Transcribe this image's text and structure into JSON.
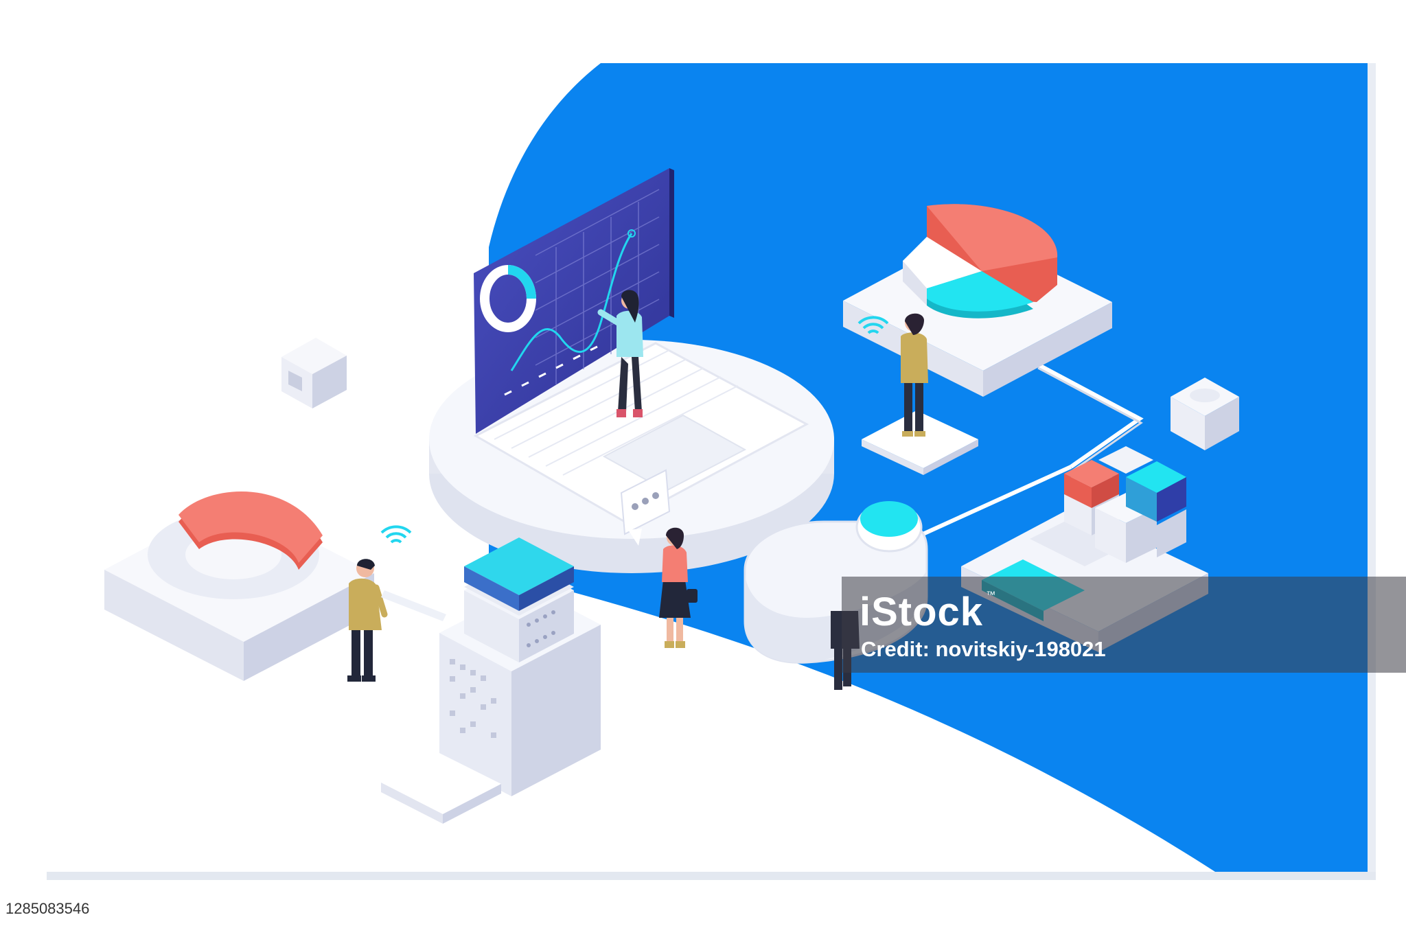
{
  "watermark": {
    "brand": "iStock",
    "tm": "™",
    "credit": "Credit: novitskiy-198021"
  },
  "image_id": "1285083546",
  "colors": {
    "blue": "#0a84f0",
    "coral": "#f47e73",
    "cyan": "#22e4f1",
    "navy": "#2f3ea8",
    "screen": "#3b3fa3",
    "platform": "#f3f5fb"
  },
  "icons": [
    "wifi-icon",
    "chat-bubble-icon",
    "donut-chart-icon",
    "pie-chart-icon",
    "line-chart-icon"
  ]
}
